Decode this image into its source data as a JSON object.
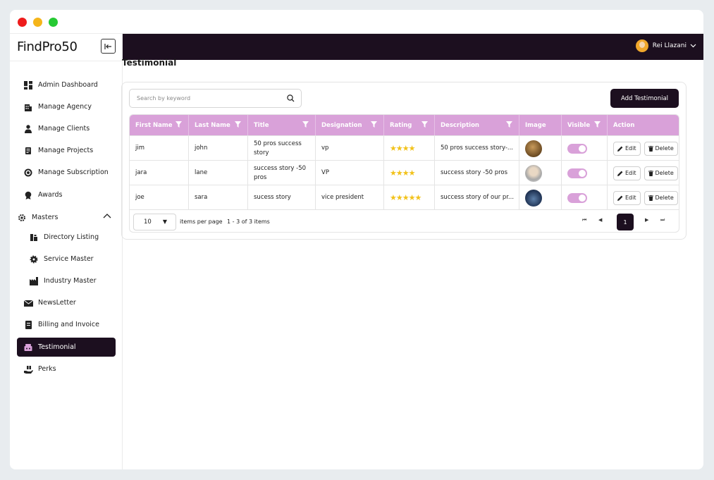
{
  "app": {
    "brand": "FindPro50"
  },
  "user": {
    "name": "Rei Llazani"
  },
  "sidebar": {
    "items": [
      {
        "label": "Admin Dashboard",
        "icon": "dashboard-icon"
      },
      {
        "label": "Manage Agency",
        "icon": "building-icon"
      },
      {
        "label": "Manage Clients",
        "icon": "user-icon"
      },
      {
        "label": "Manage Projects",
        "icon": "scroll-icon"
      },
      {
        "label": "Manage Subscription",
        "icon": "subscription-icon"
      },
      {
        "label": "Awards",
        "icon": "award-icon"
      },
      {
        "label": "Masters",
        "icon": "settings-gear-icon",
        "expanded": true
      },
      {
        "label": "Directory Listing",
        "icon": "directory-icon",
        "sub": true
      },
      {
        "label": "Service Master",
        "icon": "gear-icon",
        "sub": true
      },
      {
        "label": "Industry Master",
        "icon": "industry-icon",
        "sub": true
      },
      {
        "label": "NewsLetter",
        "icon": "newsletter-icon"
      },
      {
        "label": "Billing and Invoice",
        "icon": "invoice-icon"
      },
      {
        "label": "Testimonial",
        "icon": "testimonial-icon",
        "active": true
      },
      {
        "label": "Perks",
        "icon": "perks-icon"
      }
    ]
  },
  "page": {
    "title": "Testimonial"
  },
  "search": {
    "placeholder": "Search by keyword"
  },
  "toolbar": {
    "add_label": "Add Testimonial"
  },
  "table": {
    "columns": [
      "First Name",
      "Last Name",
      "Title",
      "Designation",
      "Rating",
      "Description",
      "Image",
      "Visible",
      "Action"
    ],
    "rows": [
      {
        "first": "jim",
        "last": "john",
        "title": "50 pros success story",
        "designation": "vp",
        "rating": 4,
        "description": "50 pros success story-...",
        "visible": true
      },
      {
        "first": "jara",
        "last": "lane",
        "title": "success story -50 pros",
        "designation": "VP",
        "rating": 4,
        "description": "success story -50 pros",
        "visible": true
      },
      {
        "first": "joe",
        "last": "sara",
        "title": "sucess story",
        "designation": "vice president",
        "rating": 5,
        "description": "success story of our pr...",
        "visible": true
      }
    ],
    "edit_label": "Edit",
    "delete_label": "Delete"
  },
  "pagination": {
    "page_size": "10",
    "items_per_page_label": "items per page",
    "range": "1 - 3 of 3 items",
    "current_page": "1"
  },
  "colors": {
    "accent": "#d9a1d9",
    "dark": "#1c0f1f",
    "star": "#f2c21a"
  }
}
